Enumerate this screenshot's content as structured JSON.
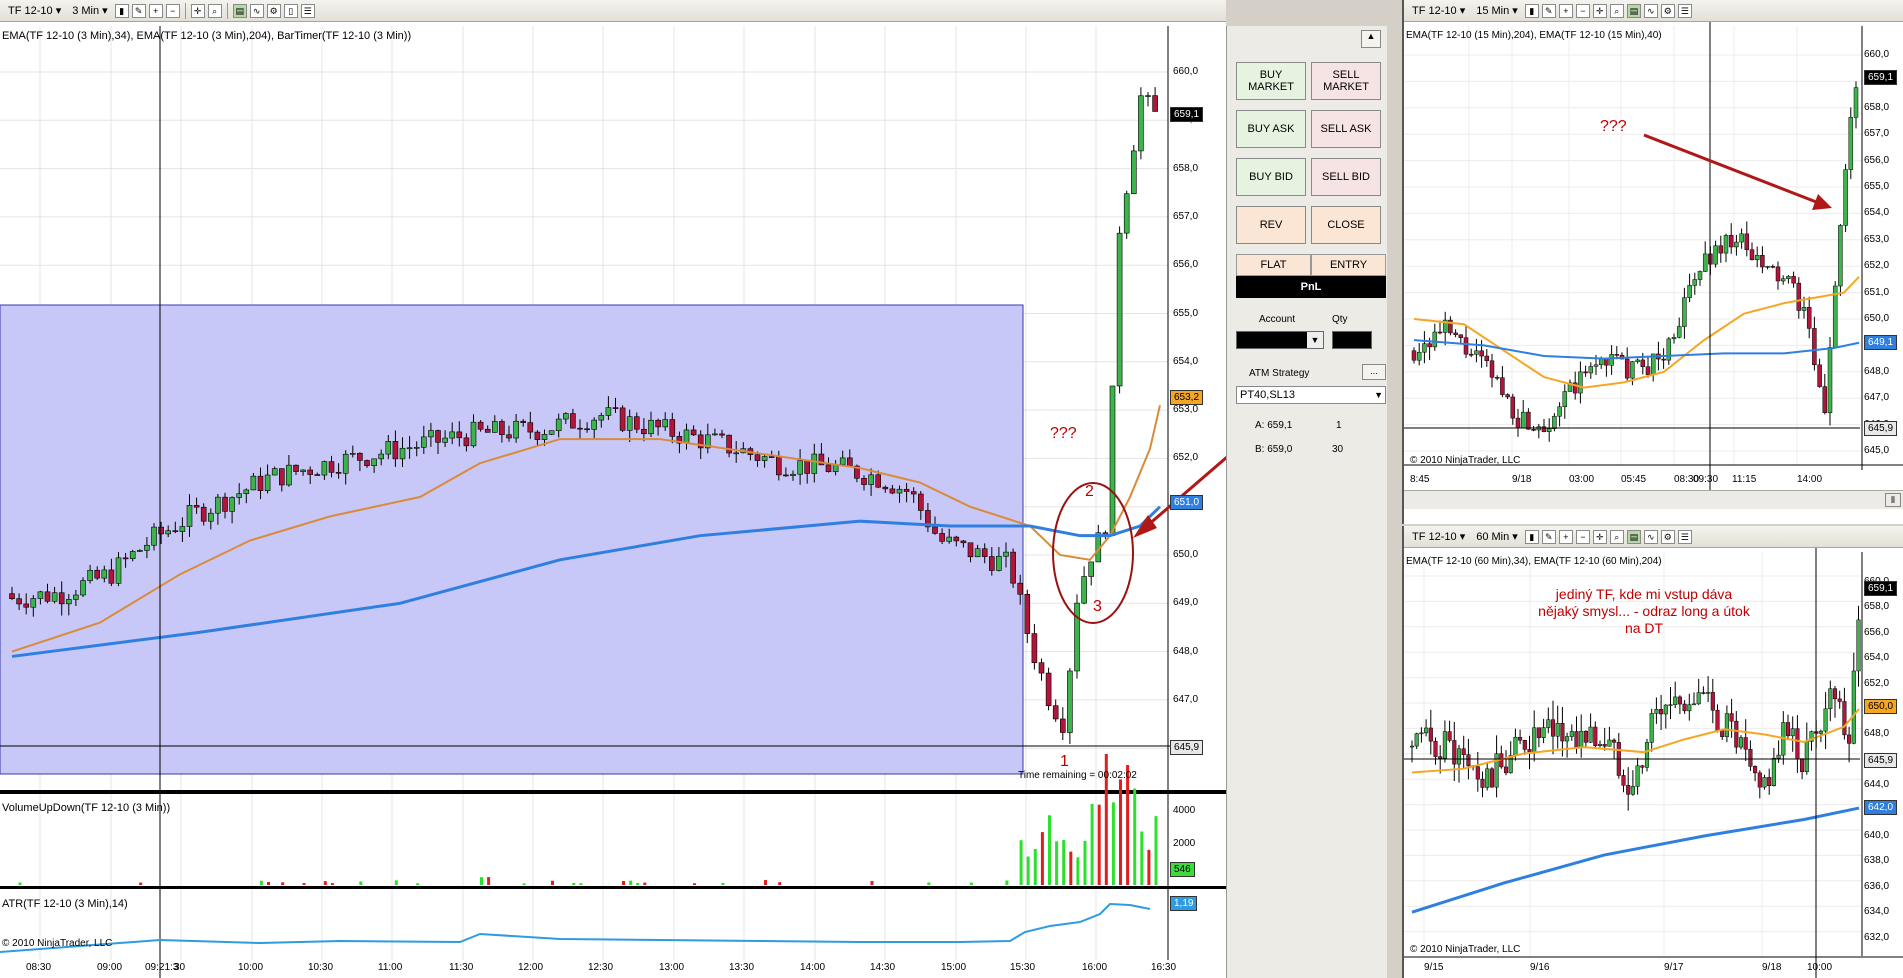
{
  "main": {
    "toolbar": {
      "instrument": "TF 12-10",
      "period": "3 Min"
    },
    "indicator_header": "EMA(TF 12-10 (3 Min),34), EMA(TF 12-10 (3 Min),204), BarTimer(TF 12-10 (3 Min))",
    "price_ticks": [
      "660,0",
      "659,0",
      "658,0",
      "657,0",
      "656,0",
      "655,0",
      "654,0",
      "653,0",
      "652,0",
      "651,0",
      "650,0",
      "649,0",
      "648,0",
      "647,0",
      "646,0"
    ],
    "time_ticks": [
      "08:30",
      "09:00",
      "09:21:3",
      "30",
      "10:00",
      "10:30",
      "11:00",
      "11:30",
      "12:00",
      "12:30",
      "13:00",
      "13:30",
      "14:00",
      "14:30",
      "15:00",
      "15:30",
      "16:00",
      "16:30"
    ],
    "tag_last": "659,1",
    "tag_ema34": "653,2",
    "tag_ema204": "651,0",
    "tag_line": "645,9",
    "bar_timer": "Time remaining = 00:02:02",
    "annotation_question": "???",
    "annotation_1": "1",
    "annotation_2": "2",
    "annotation_3": "3",
    "volume_title": "VolumeUpDown(TF 12-10 (3 Min))",
    "volume_ticks": [
      "4000",
      "2000"
    ],
    "volume_tag": "546",
    "atr_title": "ATR(TF 12-10 (3 Min),14)",
    "atr_tag": "1,19",
    "copyright": "© 2010 NinjaTrader, LLC"
  },
  "panel": {
    "buy_market": "BUY MARKET",
    "sell_market": "SELL MARKET",
    "buy_ask": "BUY ASK",
    "sell_ask": "SELL ASK",
    "buy_bid": "BUY BID",
    "sell_bid": "SELL BID",
    "rev": "REV",
    "close": "CLOSE",
    "flat": "FLAT",
    "entry": "ENTRY",
    "pnl": "PnL",
    "account_label": "Account",
    "qty_label": "Qty",
    "atm_label": "ATM Strategy",
    "atm_value": "PT40,SL13",
    "ask_label": "A: 659,1",
    "ask_qty": "1",
    "bid_label": "B: 659,0",
    "bid_qty": "30"
  },
  "tr": {
    "toolbar": {
      "instrument": "TF 12-10",
      "period": "15 Min"
    },
    "indicator_header": "EMA(TF 12-10 (15 Min),204), EMA(TF 12-10 (15 Min),40)",
    "price_ticks": [
      "660,0",
      "659,0",
      "658,0",
      "657,0",
      "656,0",
      "655,0",
      "654,0",
      "653,0",
      "652,0",
      "651,0",
      "650,0",
      "649,0",
      "648,0",
      "647,0",
      "646,0",
      "645,0"
    ],
    "time_ticks": [
      "8:45",
      "9/18",
      "03:00",
      "05:45",
      "08:30",
      "09:30",
      "11:15",
      "14:00"
    ],
    "tag_last": "659,1",
    "tag_ema": "649,1",
    "tag_line": "645,9",
    "annotation_question": "???",
    "copyright": "© 2010 NinjaTrader, LLC"
  },
  "br": {
    "toolbar": {
      "instrument": "TF 12-10",
      "period": "60 Min"
    },
    "indicator_header": "EMA(TF 12-10 (60 Min),34), EMA(TF 12-10 (60 Min),204)",
    "price_ticks": [
      "660,0",
      "658,0",
      "656,0",
      "654,0",
      "652,0",
      "650,0",
      "648,0",
      "646,0",
      "644,0",
      "642,0",
      "640,0",
      "638,0",
      "636,0",
      "634,0",
      "632,0"
    ],
    "time_ticks": [
      "9/15",
      "9/16",
      "9/17",
      "9/18",
      "10:00"
    ],
    "tag_last": "659,1",
    "tag_ema34": "650,0",
    "tag_line": "645,9",
    "tag_ema204": "642,0",
    "note": "jediný TF, kde mi vstup dáva nějaký smysl... - odraz long a útok na DT",
    "copyright": "© 2010 NinjaTrader, LLC"
  },
  "colors": {
    "up": "#3cb44b",
    "down": "#b0163a",
    "ema_fast": "#d98b3a",
    "ema_slow": "#2f7fe0",
    "box": "#c8c8f8",
    "note": "#c00000"
  }
}
